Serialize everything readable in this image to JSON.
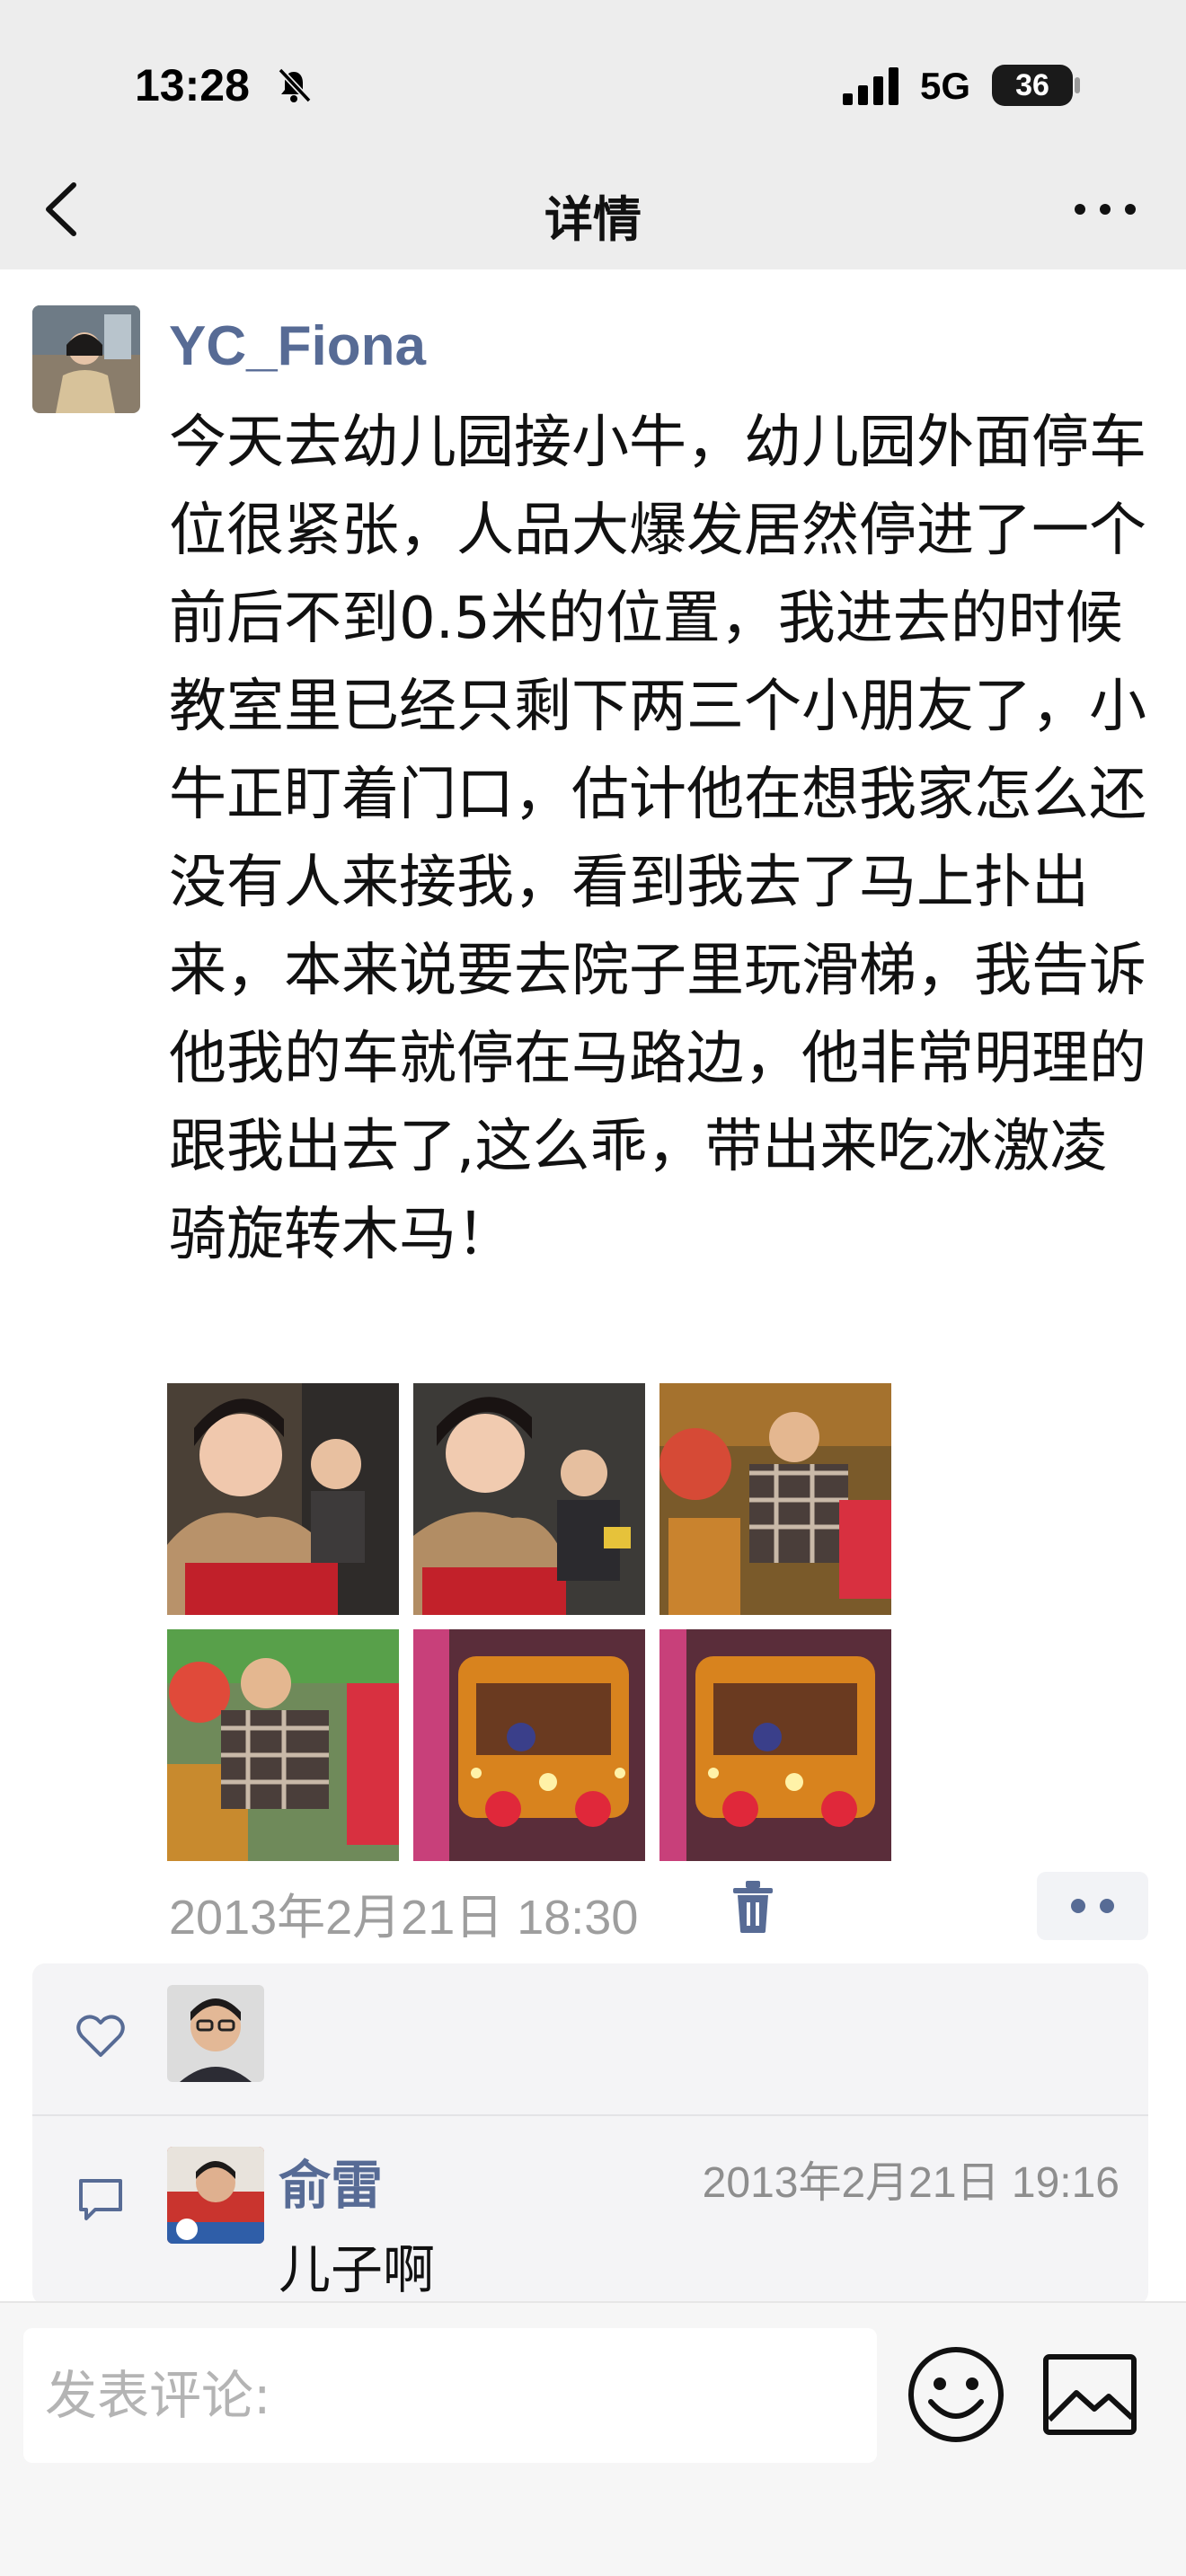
{
  "status_bar": {
    "time": "13:28",
    "network": "5G",
    "battery": "36",
    "icons": [
      "bell-off-icon",
      "signal-icon",
      "battery-icon"
    ]
  },
  "nav": {
    "title": "详情",
    "back_icon": "chevron-left-icon",
    "more_icon": "more-horizontal-icon"
  },
  "post": {
    "username": "YC_Fiona",
    "text": "今天去幼儿园接小牛，幼儿园外面停车位很紧张，人品大爆发居然停进了一个前后不到0.5米的位置，我进去的时候教室里已经只剩下两三个小朋友了，小牛正盯着门口，估计他在想我家怎么还没有人来接我，看到我去了马上扑出来，本来说要去院子里玩滑梯，我告诉他我的车就停在马路边，他非常明理的跟我出去了,这么乖，带出来吃冰激凌骑旋转木马！",
    "photo_count": 6,
    "timestamp": "2013年2月21日 18:30",
    "action_icons": [
      "trash-icon",
      "more-dots-icon"
    ]
  },
  "interactions": {
    "like_icon": "heart-icon",
    "comment_icon": "comment-icon",
    "comments": [
      {
        "name": "俞雷",
        "time": "2013年2月21日 19:16",
        "text": "儿子啊"
      }
    ]
  },
  "composer": {
    "placeholder": "发表评论:",
    "emoji_icon": "emoji-icon",
    "image_icon": "image-icon"
  },
  "colors": {
    "link_blue": "#576b95",
    "header_bg": "#ededed",
    "muted_text": "#9e9e9e",
    "panel_bg": "#f4f4f6"
  }
}
